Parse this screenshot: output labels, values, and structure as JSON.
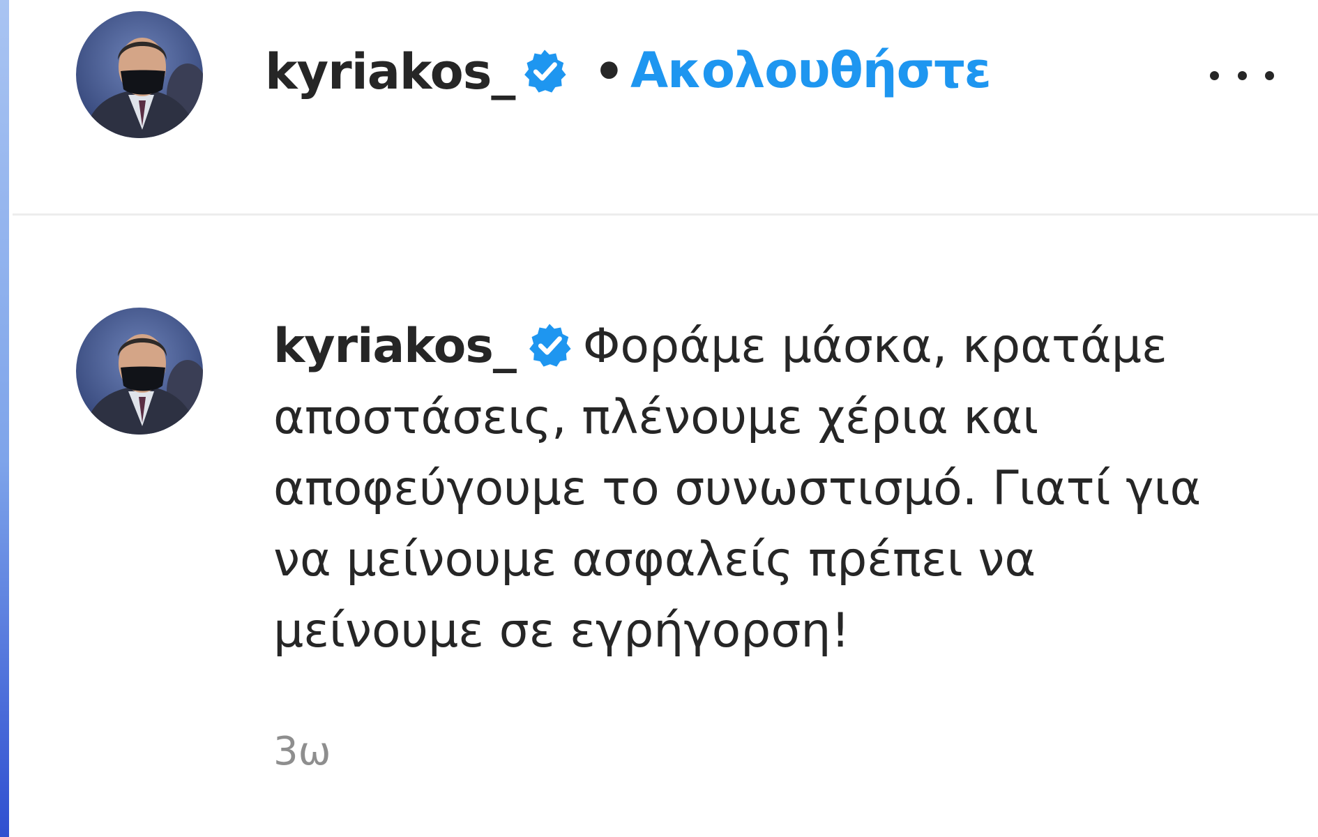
{
  "post": {
    "author": "kyriakos_",
    "verified_icon": "verified-badge-icon",
    "separator": "•",
    "follow_label": "Ακολουθήστε",
    "more_icon": "more-options-icon"
  },
  "comment": {
    "author": "kyriakos_",
    "text": "Φοράμε μάσκα, κρατάμε αποστάσεις, πλένουμε χέρια και αποφεύγουμε το συνωστισμό. Γιατί για να μείνουμε ασφαλείς πρέπει να μείνουμε σε εγρήγορση!",
    "timestamp": "3ω"
  },
  "colors": {
    "accent": "#1e96f0",
    "text": "#262626",
    "muted": "#8e8e8e",
    "divider": "#ededed"
  }
}
